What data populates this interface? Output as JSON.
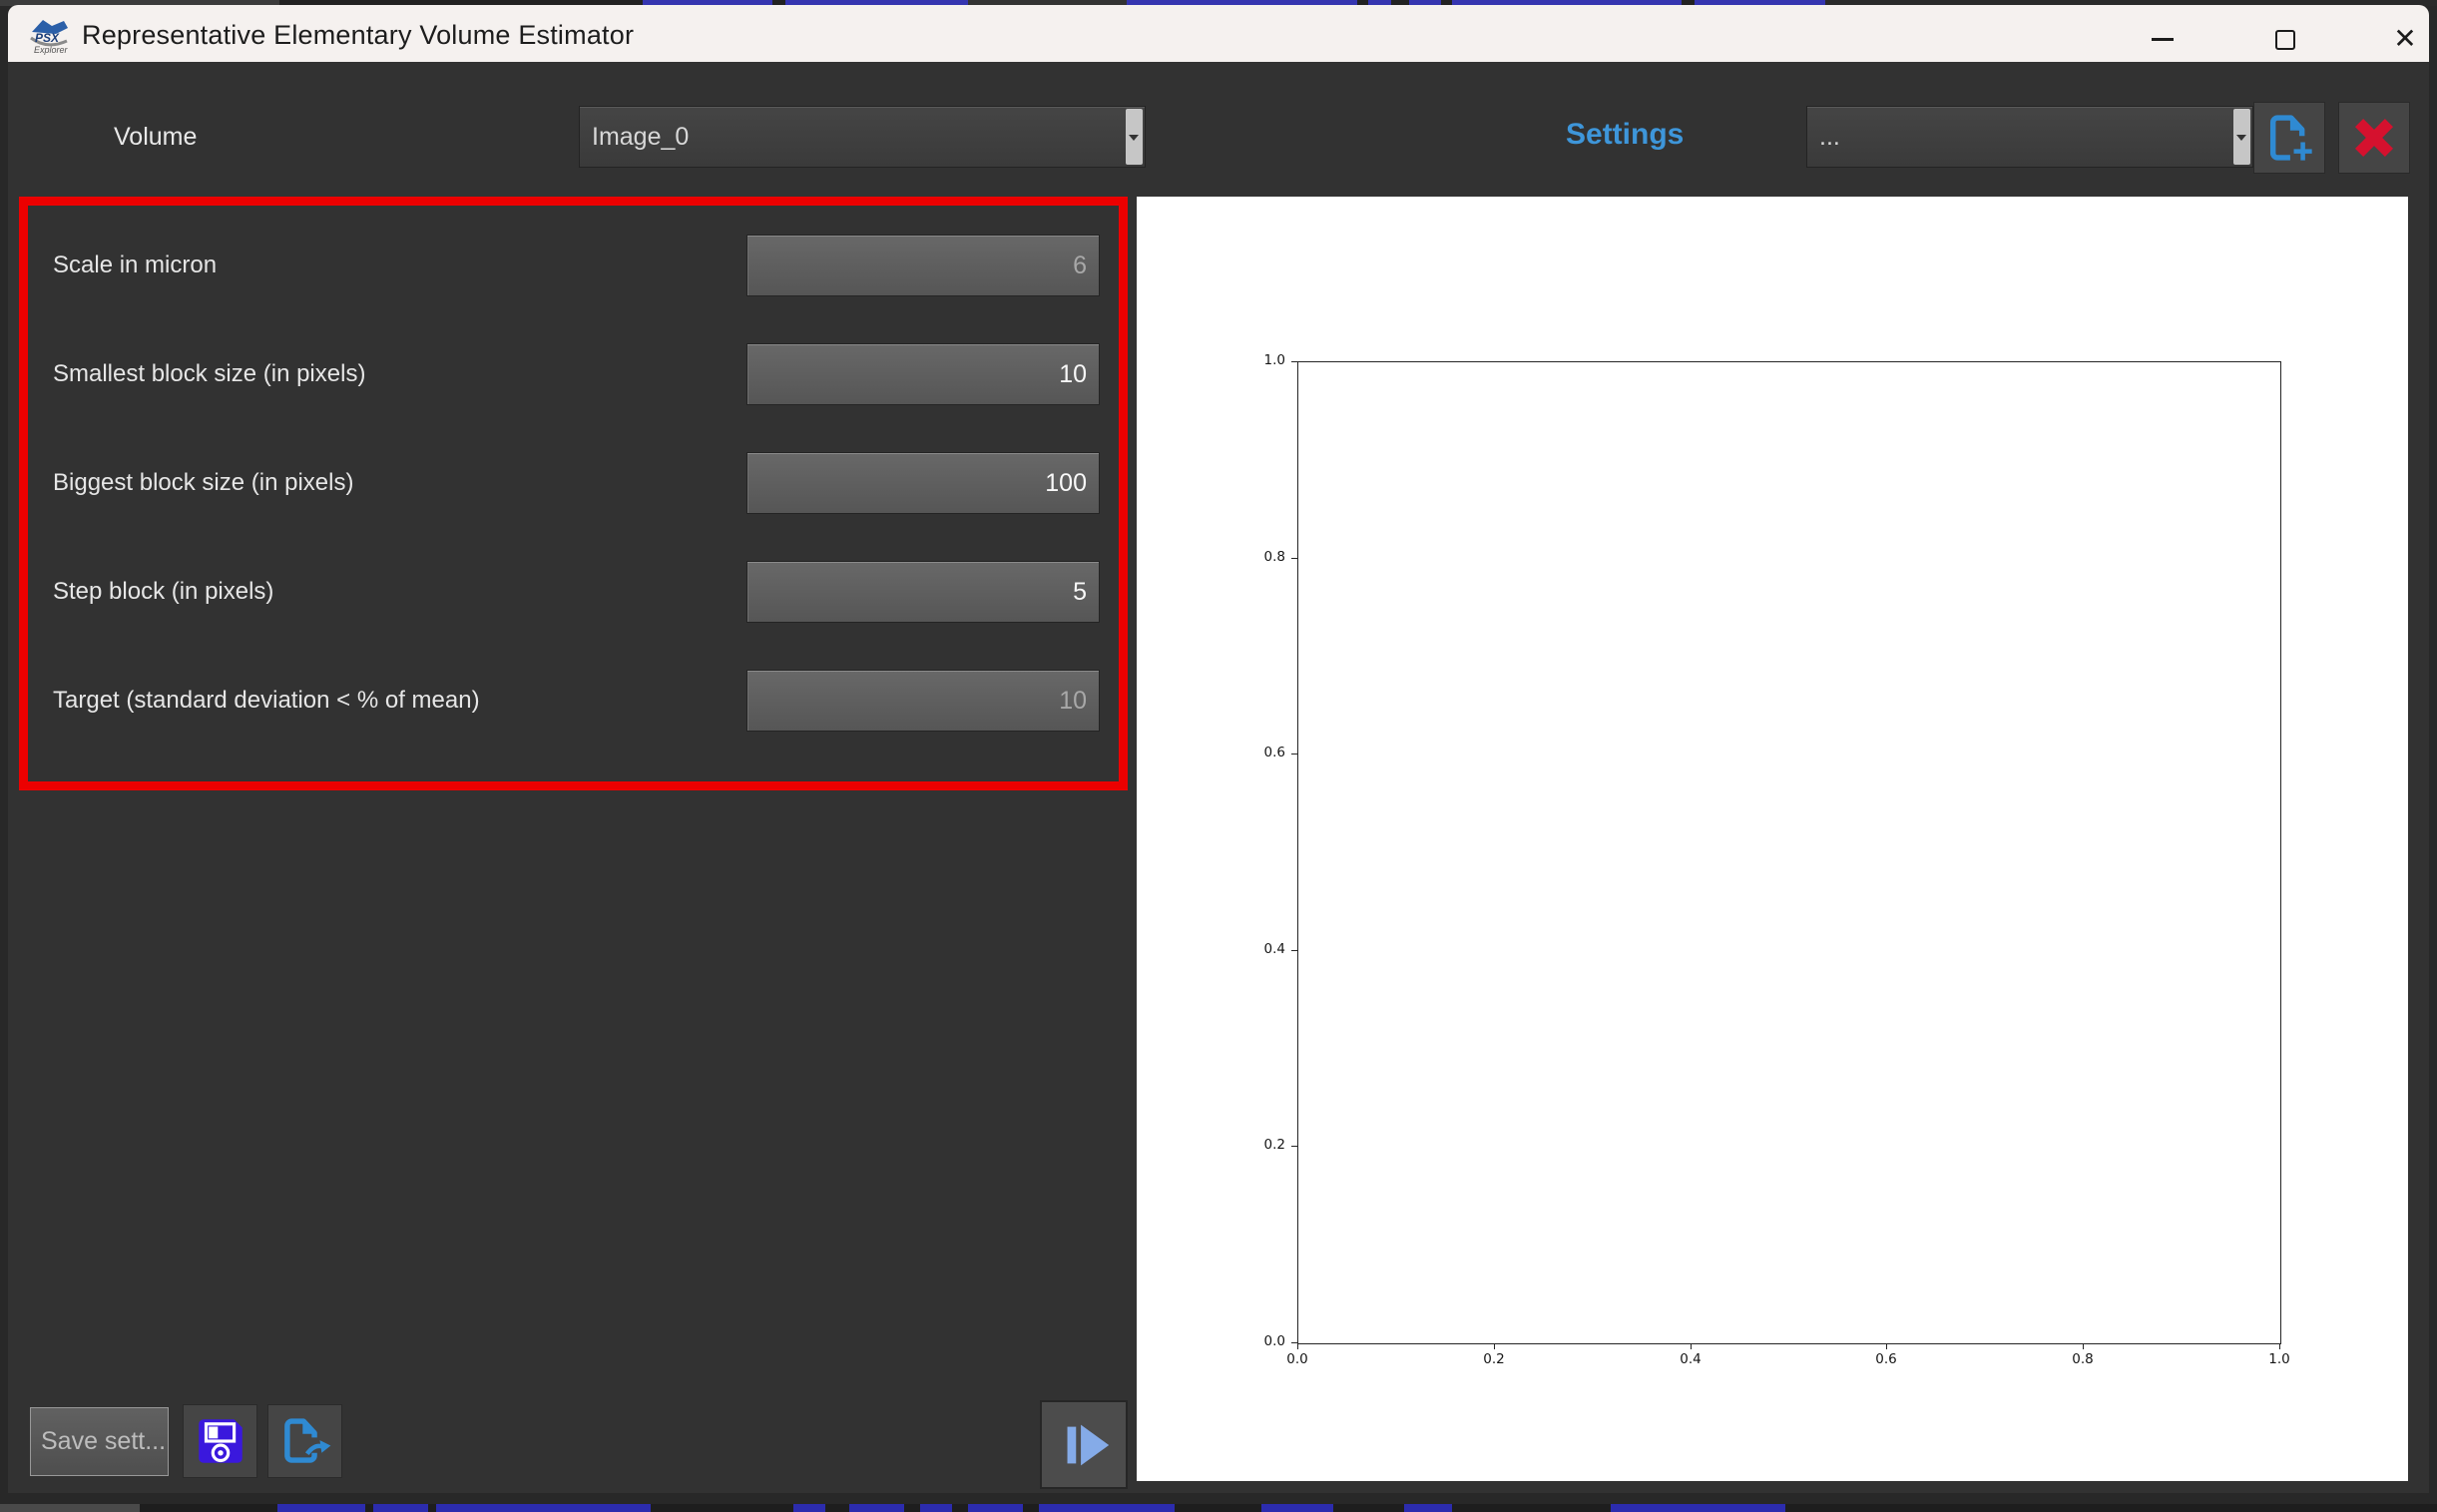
{
  "title_bar": {
    "app_name": "PSX Explorer",
    "title": "Representative Elementary Volume Estimator",
    "close_glyph": "✕"
  },
  "toolbar": {
    "volume_label": "Volume",
    "volume_value": "Image_0",
    "settings_label": "Settings",
    "settings_value": "...",
    "accent_blue": "#3e96da",
    "icon_blue": "#2f8ad2",
    "delete_red": "#d5112e"
  },
  "settings_panel": {
    "border_color": "#ec0000",
    "fields": [
      {
        "label": "Scale in micron",
        "value": "6",
        "enabled": false
      },
      {
        "label": "Smallest block size (in pixels)",
        "value": "10",
        "enabled": true
      },
      {
        "label": "Biggest block size (in pixels)",
        "value": "100",
        "enabled": true
      },
      {
        "label": "Step block (in pixels)",
        "value": "5",
        "enabled": true
      },
      {
        "label": "Target (standard deviation < % of mean)",
        "value": "10",
        "enabled": false
      }
    ]
  },
  "footer": {
    "save_settings_label": "Save sett..."
  },
  "icons": {
    "app": "psx-explorer-logo",
    "minimize": "window-minimize-dash",
    "maximize": "window-maximize-square",
    "close": "window-close-x",
    "new_settings": "file-plus",
    "delete_settings": "red-x",
    "save_disk": "floppy-disk",
    "export_file": "file-export-arrow",
    "run": "step-forward-play"
  },
  "chart_data": {
    "type": "line",
    "series": [],
    "title": "",
    "xlabel": "",
    "ylabel": "",
    "xlim": [
      0.0,
      1.0
    ],
    "ylim": [
      0.0,
      1.0
    ],
    "x_ticks": [
      0.0,
      0.2,
      0.4,
      0.6,
      0.8,
      1.0
    ],
    "y_ticks": [
      0.0,
      0.2,
      0.4,
      0.6,
      0.8,
      1.0
    ],
    "x_tick_labels": [
      "0.0",
      "0.2",
      "0.4",
      "0.6",
      "0.8",
      "1.0"
    ],
    "y_tick_labels": [
      "0.0",
      "0.2",
      "0.4",
      "0.6",
      "0.8",
      "1.0"
    ],
    "grid": false,
    "note": "empty axes, no data plotted yet"
  }
}
